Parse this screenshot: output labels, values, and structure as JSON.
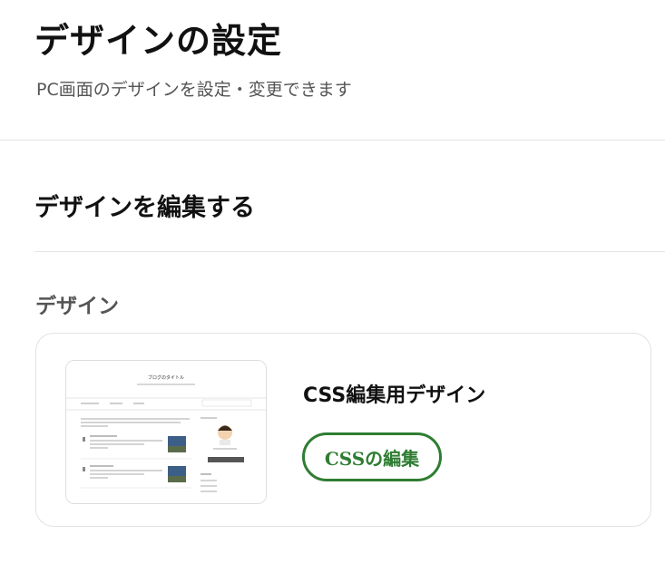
{
  "page": {
    "title": "デザインの設定",
    "description": "PC画面のデザインを設定・変更できます"
  },
  "section": {
    "title": "デザインを編集する",
    "subtitle": "デザイン"
  },
  "design_card": {
    "theme_name": "CSS編集用デザイン",
    "edit_button_label": "CSSの編集",
    "thumbnail": {
      "blog_title": "ブログのタイトル"
    }
  },
  "colors": {
    "accent": "#2e7d32",
    "title_text": "#111111",
    "muted_text": "#555555",
    "border": "#e2e2e2"
  }
}
